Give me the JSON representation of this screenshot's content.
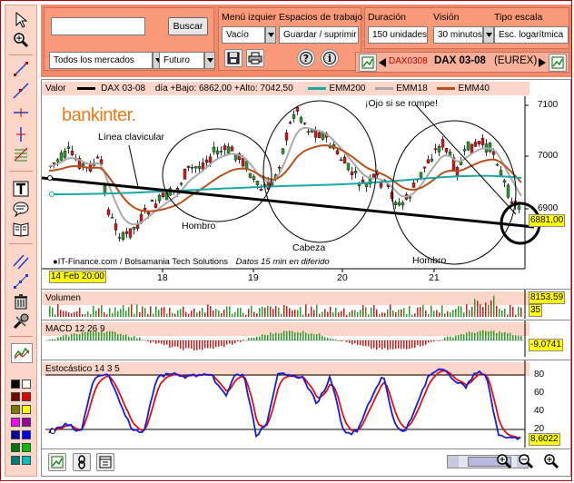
{
  "toolbar": {
    "search_placeholder": "",
    "search_button": "Buscar",
    "market_select": "Todos los mercados",
    "type_select": "Futuro",
    "menu_label": "Menú izquier",
    "menu_value": "Vacío",
    "workspace_label": "Espacios de trabajo",
    "workspace_value": "Guardar / suprimir",
    "duration_label": "Duración",
    "duration_value": "150 unidades",
    "vision_label": "Visión",
    "vision_value": "30 minutos",
    "scale_label": "Tipo escala",
    "scale_value": "Esc. logarítmica",
    "ticker_code": "DAX0308",
    "ticker_name": "DAX 03-08",
    "ticker_exchange": "(EUREX)"
  },
  "main_chart": {
    "value_label": "Valor",
    "series_name": "DAX 03-08",
    "day_info": "día +Bajo: 6862,00 +Alto: 7042,50",
    "ma_legend": [
      "EMM200",
      "EMM18",
      "EMM40"
    ],
    "brand": "bankinter.",
    "credits": "IT-Finance.com / Bolsamania Tech Solutions",
    "credits_note": "Datos 15 min en diferido",
    "date_tag": "14 Feb 20:00",
    "x_labels": [
      "18",
      "19",
      "20",
      "21"
    ],
    "y_labels": [
      "7100",
      "7000",
      "6900"
    ],
    "price_tag": "6881,00",
    "annotations": {
      "clavicular": "Línea clavicular",
      "hombro1": "Hombro",
      "cabeza": "Cabeza",
      "hombro2": "Hombro",
      "warning": "¡Ojo si se rompe!"
    }
  },
  "volume": {
    "title": "Volumen",
    "tag_top": "8153,59",
    "tag_bottom": "35"
  },
  "macd": {
    "title": "MACD 12 26 9",
    "tag": "-9,0741"
  },
  "stoch": {
    "title": "Estocástico 14 3 5",
    "y_labels": [
      "80",
      "60",
      "40",
      "20"
    ],
    "tag": "8,6022"
  },
  "colors": {
    "toolbar_bg": "#f08a6a",
    "panel_bg": "#fa9a78",
    "title_bg": "#fcd6c8",
    "candle_up": "#2e9a2e",
    "candle_down": "#c81e1e",
    "emm200": "#1aa7a7",
    "emm18": "#aaaaaa",
    "emm40": "#b8501c",
    "stoch_k": "#1a1ad0",
    "stoch_d": "#e01010",
    "tag_yellow": "#ffff00"
  },
  "palette": [
    "#000000",
    "#ffffff",
    "#7a0000",
    "#e00000",
    "#7a7a00",
    "#ffff00",
    "#ff00ff",
    "#a000a0",
    "#0000a0",
    "#0000ff",
    "#007a00",
    "#00c000",
    "#007a7a",
    "#00c0c0"
  ],
  "icons": {
    "left_tools": [
      "cursor-icon",
      "zoom-in-icon",
      "trend-line-icon",
      "line-icon",
      "horizontal-line-icon",
      "vertical-line-icon",
      "fibonacci-icon",
      "text-icon",
      "comment-icon",
      "book-icon",
      "parallel-line-icon",
      "points-icon",
      "trash-icon",
      "tools-icon",
      "indicator-icon"
    ],
    "bottom_tools": [
      "chart-icon",
      "link-icon",
      "calendar-icon",
      "zoom-in-icon",
      "zoom-out-icon",
      "search-icon"
    ]
  }
}
